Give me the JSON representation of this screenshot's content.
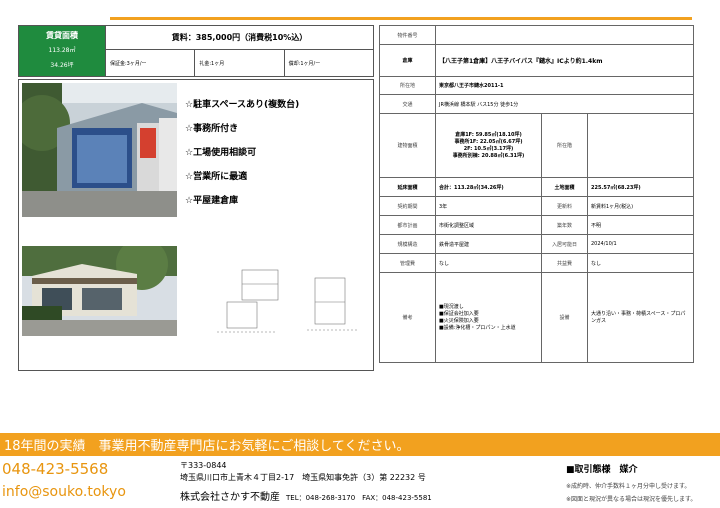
{
  "header": {
    "area_label": "賃貸面積",
    "area_sqm": "113.28㎡",
    "area_tsubo": "34.26坪",
    "rent": "賃料：385,000円（消費税10%込）",
    "deposit": "保証金:3ヶ月/ー",
    "key_money": "礼金:1ヶ月",
    "amortization": "償却:1ヶ月/ー"
  },
  "features": [
    "☆駐車スペースあり(複数台)",
    "☆事務所付き",
    "☆工場使用相談可",
    "☆営業所に最適",
    "☆平屋建倉庫"
  ],
  "table": {
    "property_no_label": "物件番号",
    "property_no": "",
    "type": "倉庫",
    "title": "【八王子第1倉庫】八王子バイパス『鑓水』ICより約1.4km",
    "location_label": "所在地",
    "location": "東京都八王子市鑓水2011-1",
    "transport_label": "交通",
    "transport": "JR横浜線 橋本駅 バス15分 徒歩1分",
    "building_area_label": "建物面積",
    "building_area_lines": [
      "倉庫1F: 59.85㎡(18.10坪)",
      "事務所1F: 22.05㎡(6.67坪)",
      "2F: 10.5㎡(3.17坪)",
      "事務所別棟: 20.88㎡(6.31坪)"
    ],
    "floor_label": "所在階",
    "floor": "",
    "total_area_label": "延床面積",
    "total_area": "合計：113.28㎡(34.26坪)",
    "land_area_label": "土地面積",
    "land_area": "225.57㎡(68.23坪)",
    "contract_label": "契約期間",
    "contract": "3年",
    "renewal_label": "更新料",
    "renewal": "新賃料1ヶ月(税込)",
    "zoning_label": "都市計画",
    "zoning": "市街化調整区域",
    "built_label": "築年数",
    "built": "不明",
    "structure_label": "規模構造",
    "structure": "鉄骨造平屋建",
    "available_label": "入居可能日",
    "available": "2024/10/1",
    "mgmt_fee_label": "管理費",
    "mgmt_fee": "なし",
    "common_fee_label": "共益費",
    "common_fee": "なし",
    "remarks_label": "備考",
    "remarks": [
      "■現況渡し",
      "■保証会社加入要",
      "■火災保険加入要",
      "■設備:浄化槽・プロパン・上水道"
    ],
    "equipment_label": "設備",
    "equipment": "大通り沿い・事務・荷積スペース・プロパンガス"
  },
  "footer": {
    "banner": "18年間の実績　事業用不動産専門店にお気軽にご相談してください。",
    "phone": "048-423-5568",
    "email": "info@souko.tokyo",
    "postal": "〒333-0844",
    "address": "埼玉県川口市上青木４丁目2-17　埼玉県知事免許（3）第 22232 号",
    "company": "株式会社さかす不動産",
    "tel_fax": "TEL：048-268-3170　FAX：048-423-5581",
    "deal_type": "■取引態様　媒介",
    "note1": "※成約時、仲介手数料１ヶ月分申し受けます。",
    "note2": "※図面と現況が異なる場合は現況を優先します。"
  },
  "colors": {
    "accent": "#f2a11f",
    "area_green": "#1f8b3e"
  }
}
